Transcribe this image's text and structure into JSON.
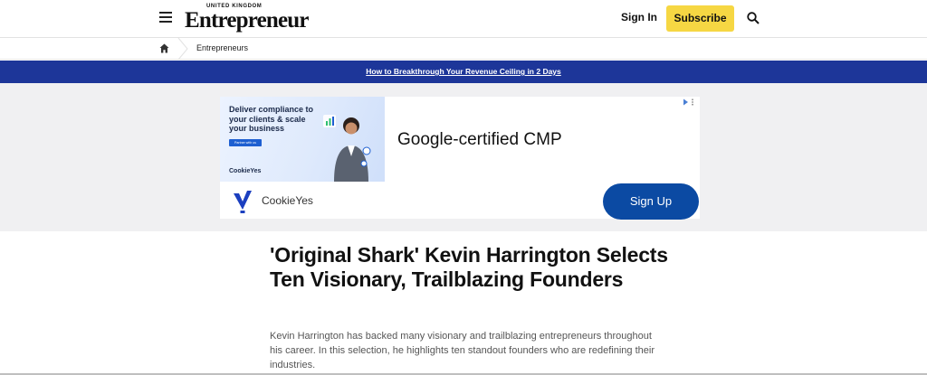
{
  "header": {
    "logo_small": "UNITED KINGDOM",
    "logo_main": "Entrepreneur",
    "signin_label": "Sign In",
    "subscribe_label": "Subscribe",
    "icons": [
      "menu-icon",
      "search-icon"
    ],
    "accent_color": "#f6d743"
  },
  "breadcrumb": {
    "home_icon": "home-icon",
    "item": "Entrepreneurs"
  },
  "promo": {
    "text": "How to Breakthrough Your Revenue Ceiling in 2 Days",
    "background": "#1d3699"
  },
  "ad": {
    "creative_headline": "Deliver compliance to your clients & scale your business",
    "creative_button": "Partner with us",
    "creative_brand": "CookieYes",
    "headline": "Google-certified CMP",
    "advertiser": "CookieYes",
    "cta_label": "Sign Up",
    "cta_color": "#0b4aa3"
  },
  "article": {
    "title": "'Original Shark' Kevin Harrington Selects Ten Visionary, Trailblazing Founders",
    "dek": "Kevin Harrington has backed many visionary and trailblazing entrepreneurs throughout his career. In this selection, he highlights ten standout founders who are redefining their industries."
  }
}
